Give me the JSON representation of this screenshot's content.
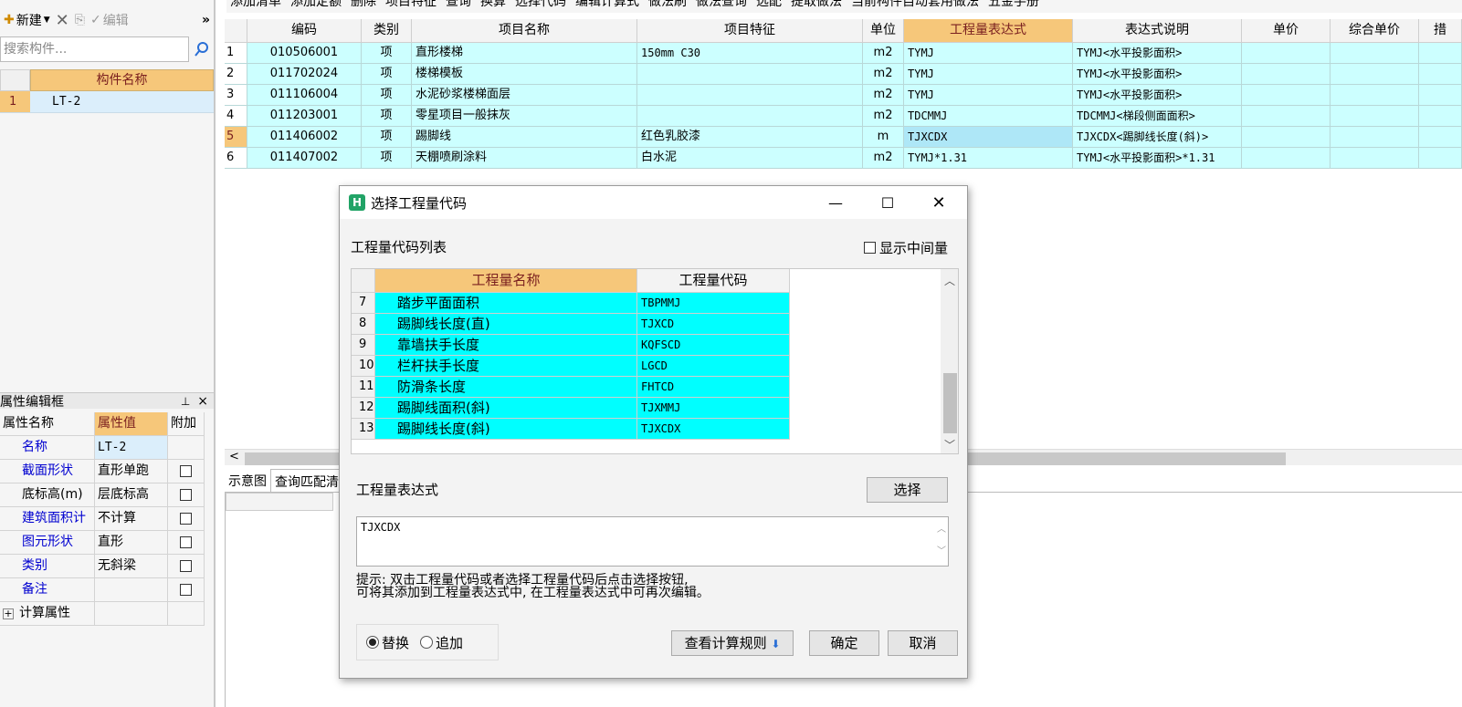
{
  "left_panel": {
    "toolbar": {
      "new_label": "新建",
      "edit_label": "编辑",
      "more": "»"
    },
    "search": {
      "placeholder": "搜索构件..."
    },
    "component_table": {
      "header": "构件名称",
      "rows": [
        {
          "index": "1",
          "name": "LT-2"
        }
      ]
    },
    "property_editor": {
      "title": "属性编辑框",
      "pin": "🖈",
      "close": "×",
      "headers": {
        "name": "属性名称",
        "value": "属性值",
        "extra": "附加"
      },
      "rows": [
        {
          "name": "名称",
          "value": "LT-2",
          "has_check": false
        },
        {
          "name": "截面形状",
          "value": "直形单跑",
          "has_check": true
        },
        {
          "name": "底标高(m)",
          "value": "层底标高",
          "has_check": true
        },
        {
          "name": "建筑面积计",
          "value": "不计算",
          "has_check": true
        },
        {
          "name": "图元形状",
          "value": "直形",
          "has_check": true
        },
        {
          "name": "类别",
          "value": "无斜梁",
          "has_check": true
        },
        {
          "name": "备注",
          "value": "",
          "has_check": true
        }
      ],
      "group": {
        "expand": "+",
        "label": "计算属性"
      }
    }
  },
  "main_toolbar": {
    "items": [
      "添加清单",
      "添加定额",
      "删除",
      "项目特征",
      "查询",
      "换算",
      "选择代码",
      "编辑计算式",
      "做法刷",
      "做法查询",
      "选配",
      "提取做法",
      "当前构件自动套用做法",
      "五金手册"
    ]
  },
  "grid": {
    "headers": [
      "编码",
      "类别",
      "项目名称",
      "项目特征",
      "单位",
      "工程量表达式",
      "表达式说明",
      "单价",
      "综合单价",
      "措"
    ],
    "rows": [
      {
        "idx": "1",
        "code": "010506001",
        "type": "项",
        "name": "直形楼梯",
        "feature": "150mm C30",
        "unit": "m2",
        "expr": "TYMJ",
        "desc": "TYMJ<水平投影面积>",
        "price": "",
        "total": ""
      },
      {
        "idx": "2",
        "code": "011702024",
        "type": "项",
        "name": "楼梯模板",
        "feature": "",
        "unit": "m2",
        "expr": "TYMJ",
        "desc": "TYMJ<水平投影面积>",
        "price": "",
        "total": ""
      },
      {
        "idx": "3",
        "code": "011106004",
        "type": "项",
        "name": "水泥砂浆楼梯面层",
        "feature": "",
        "unit": "m2",
        "expr": "TYMJ",
        "desc": "TYMJ<水平投影面积>",
        "price": "",
        "total": ""
      },
      {
        "idx": "4",
        "code": "011203001",
        "type": "项",
        "name": "零星项目一般抹灰",
        "feature": "",
        "unit": "m2",
        "expr": "TDCMMJ",
        "desc": "TDCMMJ<梯段侧面面积>",
        "price": "",
        "total": ""
      },
      {
        "idx": "5",
        "code": "011406002",
        "type": "项",
        "name": "踢脚线",
        "feature": "红色乳胶漆",
        "unit": "m",
        "expr": "TJXCDX",
        "desc": "TJXCDX<踢脚线长度(斜)>",
        "price": "",
        "total": ""
      },
      {
        "idx": "6",
        "code": "011407002",
        "type": "项",
        "name": "天棚喷刷涂料",
        "feature": "白水泥",
        "unit": "m2",
        "expr": "TYMJ*1.31",
        "desc": "TYMJ<水平投影面积>*1.31",
        "price": "",
        "total": ""
      }
    ],
    "selected_row": 5
  },
  "bottom_tabs": [
    "示意图",
    "查询匹配清"
  ],
  "dialog": {
    "title": "选择工程量代码",
    "list_label": "工程量代码列表",
    "show_middle": "显示中间量",
    "list_headers": {
      "name": "工程量名称",
      "code": "工程量代码"
    },
    "list_rows": [
      {
        "idx": "7",
        "name": "踏步平面面积",
        "code": "TBPMMJ"
      },
      {
        "idx": "8",
        "name": "踢脚线长度(直)",
        "code": "TJXCD"
      },
      {
        "idx": "9",
        "name": "靠墙扶手长度",
        "code": "KQFSCD"
      },
      {
        "idx": "10",
        "name": "栏杆扶手长度",
        "code": "LGCD"
      },
      {
        "idx": "11",
        "name": "防滑条长度",
        "code": "FHTCD"
      },
      {
        "idx": "12",
        "name": "踢脚线面积(斜)",
        "code": "TJXMMJ"
      },
      {
        "idx": "13",
        "name": "踢脚线长度(斜)",
        "code": "TJXCDX"
      }
    ],
    "expr_label": "工程量表达式",
    "select_button": "选择",
    "expr_value": "TJXCDX",
    "hint_line1": "提示: 双击工程量代码或者选择工程量代码后点击选择按钮,",
    "hint_line2": "可将其添加到工程量表达式中, 在工程量表达式中可再次编辑。",
    "mode_replace": "替换",
    "mode_append": "追加",
    "rules_button": "查看计算规则",
    "ok_button": "确定",
    "cancel_button": "取消",
    "accent": "#f6c77a",
    "cyan": "#00ffff"
  }
}
